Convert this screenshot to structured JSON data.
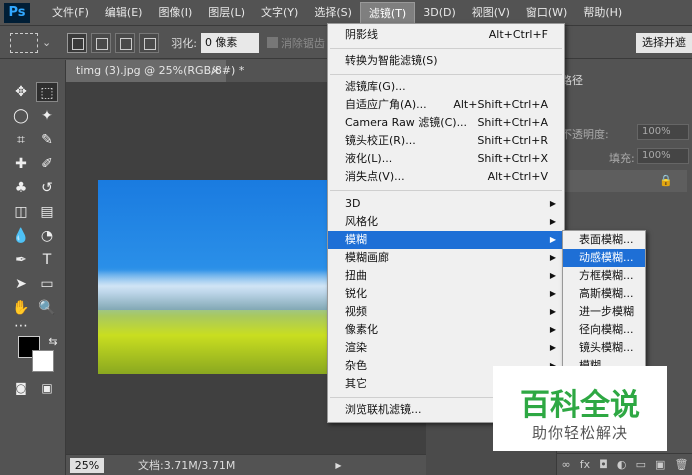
{
  "app": {
    "logo": "Ps"
  },
  "menubar": [
    "文件(F)",
    "编辑(E)",
    "图像(I)",
    "图层(L)",
    "文字(Y)",
    "选择(S)",
    "滤镜(T)",
    "3D(D)",
    "视图(V)",
    "窗口(W)",
    "帮助(H)"
  ],
  "options": {
    "feather_label": "羽化:",
    "feather_value": "0 像素",
    "antialias_label": "消除锯齿",
    "select_subject": "选择并遮"
  },
  "document": {
    "tab_title": "timg (3).jpg @ 25%(RGB/8#) *",
    "close": "×",
    "zoom": "25%",
    "doc_info": "文档:3.71M/3.71M",
    "arrow": "▶"
  },
  "filter_menu": {
    "items": [
      {
        "label": "阴影线",
        "shortcut": "Alt+Ctrl+F"
      },
      {
        "label": "转换为智能滤镜(S)",
        "shortcut": ""
      },
      {
        "label": "滤镜库(G)...",
        "shortcut": ""
      },
      {
        "label": "自适应广角(A)...",
        "shortcut": "Alt+Shift+Ctrl+A"
      },
      {
        "label": "Camera Raw 滤镜(C)...",
        "shortcut": "Shift+Ctrl+A"
      },
      {
        "label": "镜头校正(R)...",
        "shortcut": "Shift+Ctrl+R"
      },
      {
        "label": "液化(L)...",
        "shortcut": "Shift+Ctrl+X"
      },
      {
        "label": "消失点(V)...",
        "shortcut": "Alt+Ctrl+V"
      },
      {
        "label": "3D",
        "shortcut": ""
      },
      {
        "label": "风格化",
        "shortcut": ""
      },
      {
        "label": "模糊",
        "shortcut": ""
      },
      {
        "label": "模糊画廊",
        "shortcut": ""
      },
      {
        "label": "扭曲",
        "shortcut": ""
      },
      {
        "label": "锐化",
        "shortcut": ""
      },
      {
        "label": "视频",
        "shortcut": ""
      },
      {
        "label": "像素化",
        "shortcut": ""
      },
      {
        "label": "渲染",
        "shortcut": ""
      },
      {
        "label": "杂色",
        "shortcut": ""
      },
      {
        "label": "其它",
        "shortcut": ""
      },
      {
        "label": "浏览联机滤镜...",
        "shortcut": ""
      }
    ]
  },
  "blur_submenu": {
    "items": [
      "表面模糊...",
      "动感模糊...",
      "方框模糊...",
      "高斯模糊...",
      "进一步模糊",
      "径向模糊...",
      "镜头模糊...",
      "模糊"
    ]
  },
  "right_panel": {
    "tab": "路径",
    "opacity_label": "不透明度:",
    "opacity_value": "100%",
    "fill_label": "填充:",
    "fill_value": "100%",
    "lock": "🔒",
    "footer": [
      "∞",
      "fx",
      "◘",
      "◐",
      "▭",
      "▣",
      "🗑"
    ]
  },
  "watermark": {
    "title": "百科全说",
    "subtitle": "助你轻松解决"
  },
  "colors": {
    "accent": "#1e6fd6",
    "watermark_green": "#2ea843"
  }
}
